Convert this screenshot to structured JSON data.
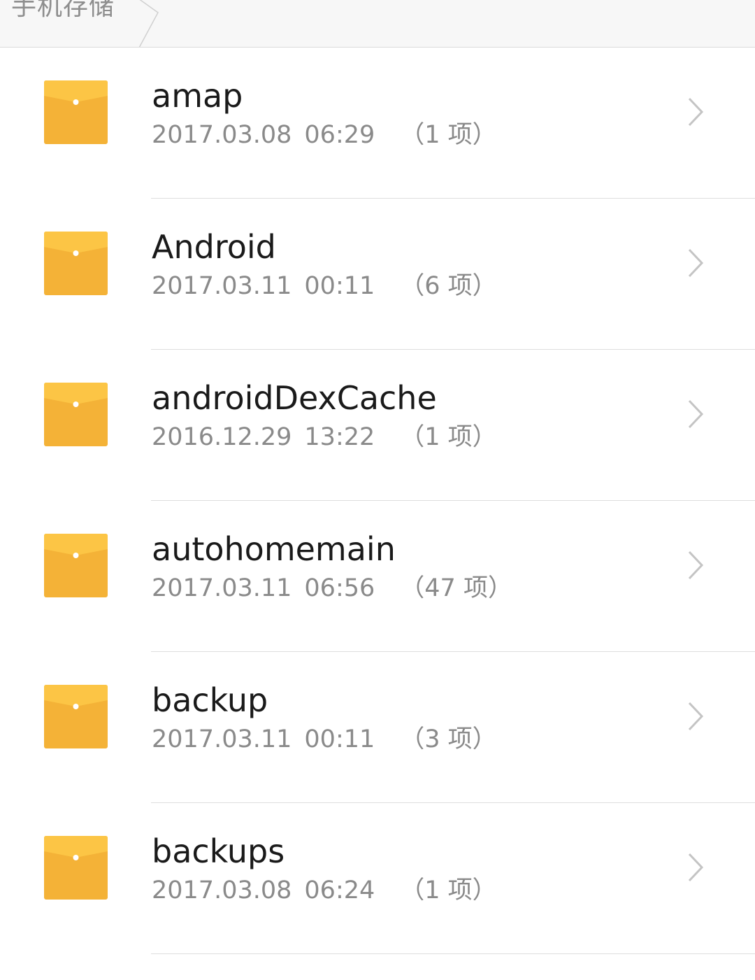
{
  "breadcrumb": {
    "current": "手机存储"
  },
  "colors": {
    "folder_top": "#fcc545",
    "folder_body": "#f4b237",
    "text_primary": "#1a1a1a",
    "text_secondary": "#8a8a8a",
    "chevron": "#c4c4c4"
  },
  "folders": [
    {
      "name": "amap",
      "date": "2017.03.08",
      "time": "06:29",
      "count": "（1 项）"
    },
    {
      "name": "Android",
      "date": "2017.03.11",
      "time": "00:11",
      "count": "（6 项）"
    },
    {
      "name": "androidDexCache",
      "date": "2016.12.29",
      "time": "13:22",
      "count": "（1 项）"
    },
    {
      "name": "autohomemain",
      "date": "2017.03.11",
      "time": "06:56",
      "count": "（47 项）"
    },
    {
      "name": "backup",
      "date": "2017.03.11",
      "time": "00:11",
      "count": "（3 项）"
    },
    {
      "name": "backups",
      "date": "2017.03.08",
      "time": "06:24",
      "count": "（1 项）"
    }
  ],
  "icons": {
    "folder": "folder-icon",
    "chevron": "chevron-right-icon",
    "separator": "breadcrumb-separator-icon"
  }
}
